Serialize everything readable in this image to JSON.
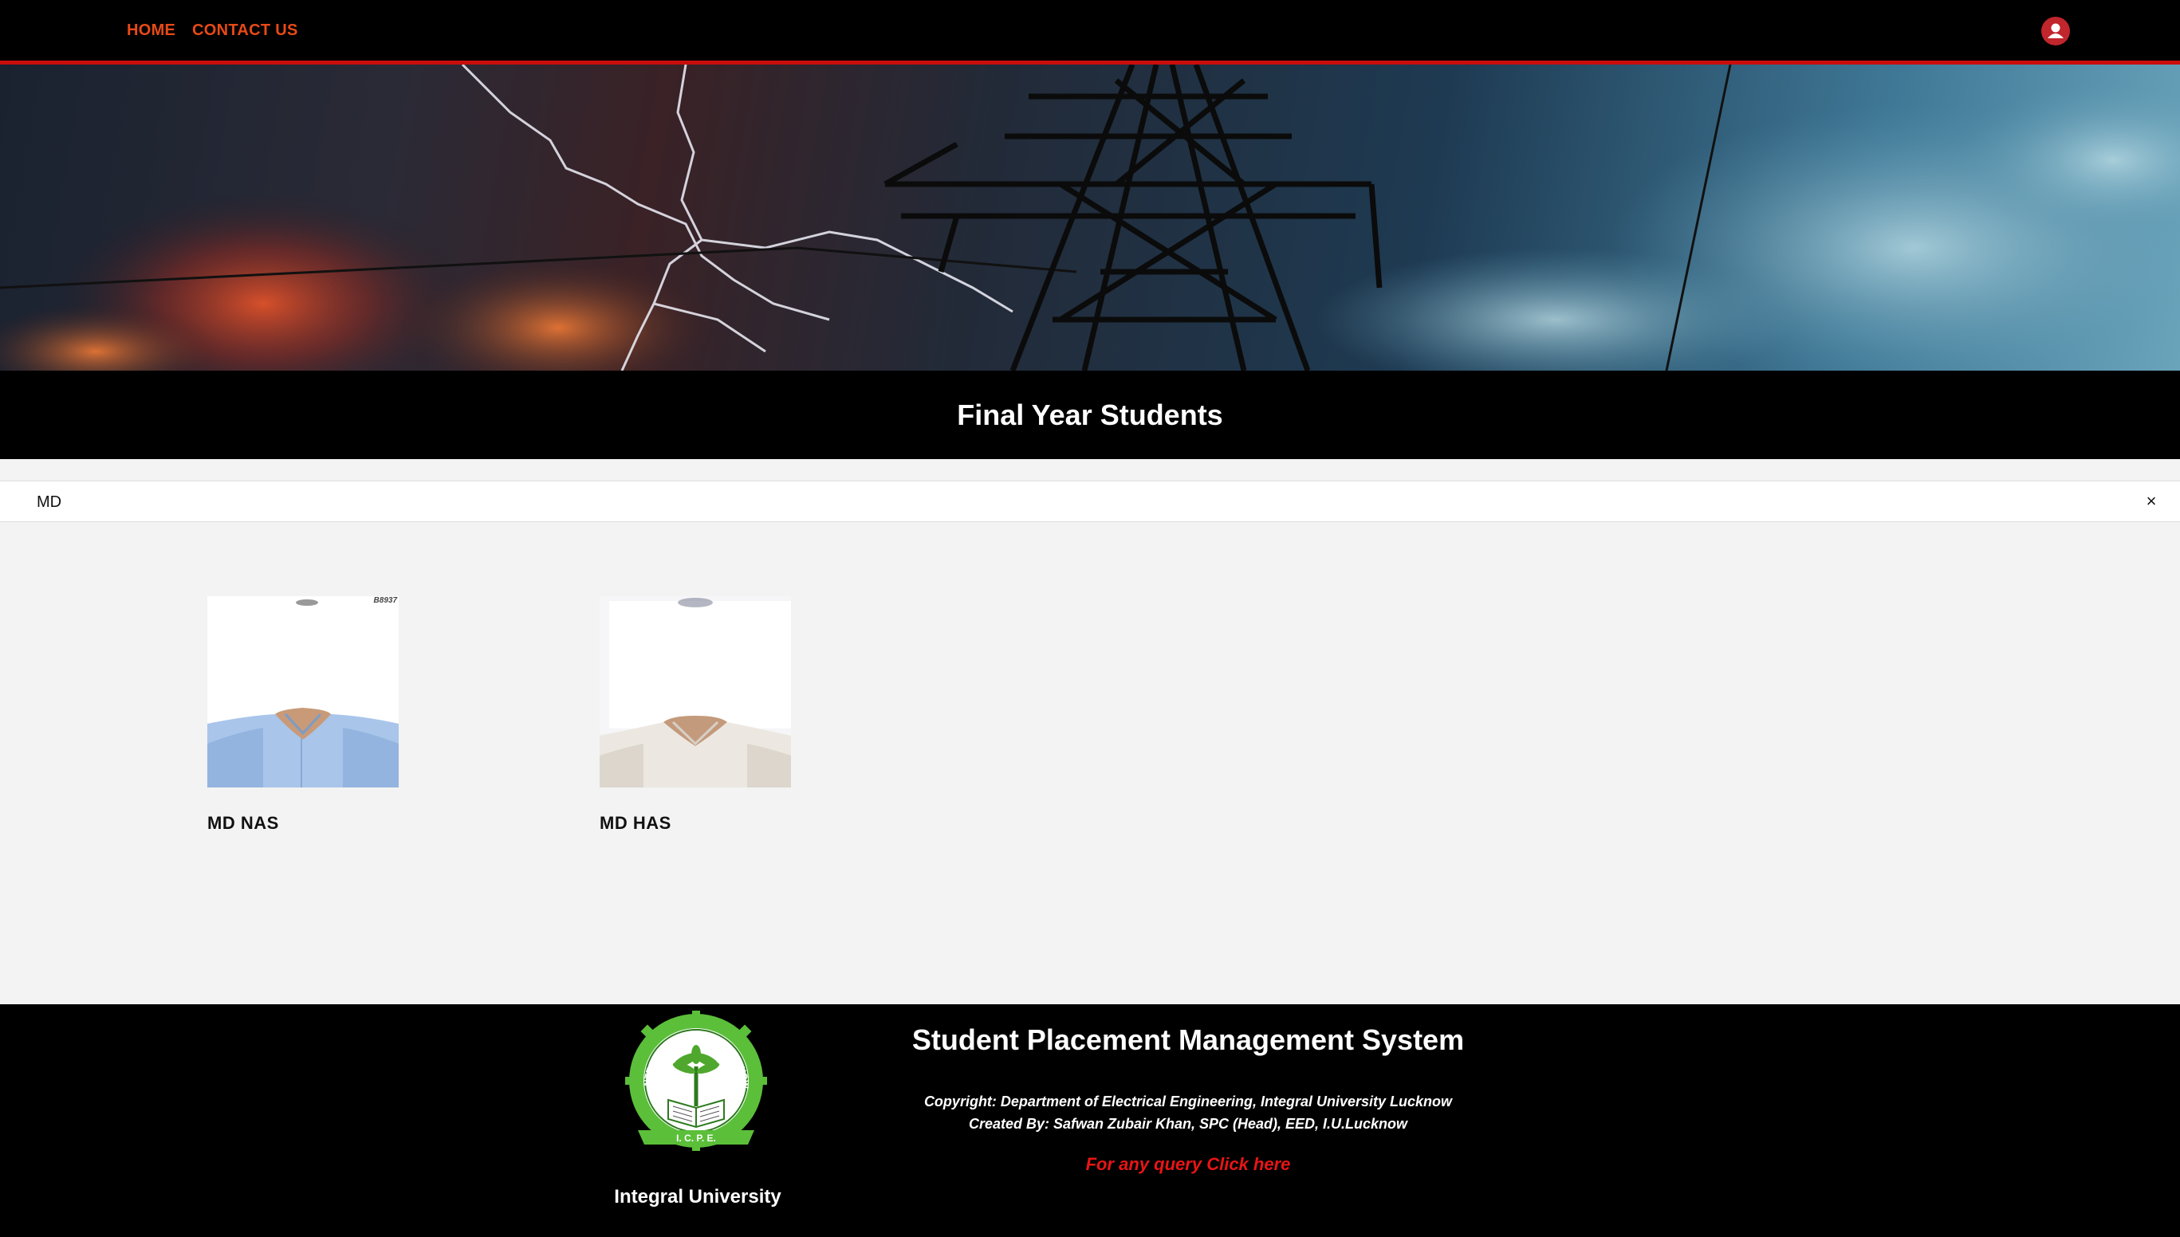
{
  "nav": {
    "home_label": "HOME",
    "contact_label": "CONTACT US",
    "user_icon": "user-icon"
  },
  "page": {
    "title": "Final Year Students"
  },
  "search": {
    "value": "MD",
    "clear_glyph": "×"
  },
  "students": [
    {
      "name": "MD NAS",
      "photo_code": "B8937"
    },
    {
      "name": "MD HAS"
    }
  ],
  "footer": {
    "university": "Integral University",
    "system_title": "Student Placement Management System",
    "copyright": "Copyright: Department of Electrical Engineering, Integral University Lucknow",
    "created_by": "Created By: Safwan Zubair Khan, SPC (Head), EED, I.U.Lucknow",
    "query_link": "For any query Click here",
    "logo_text": "INTEGRAL UNIVERSITY, LUCKNOW",
    "logo_ribbon": "I. C. P. E."
  },
  "colors": {
    "nav_accent": "#e84a17",
    "nav_border": "#c90d0d",
    "query_link": "#e81515"
  }
}
